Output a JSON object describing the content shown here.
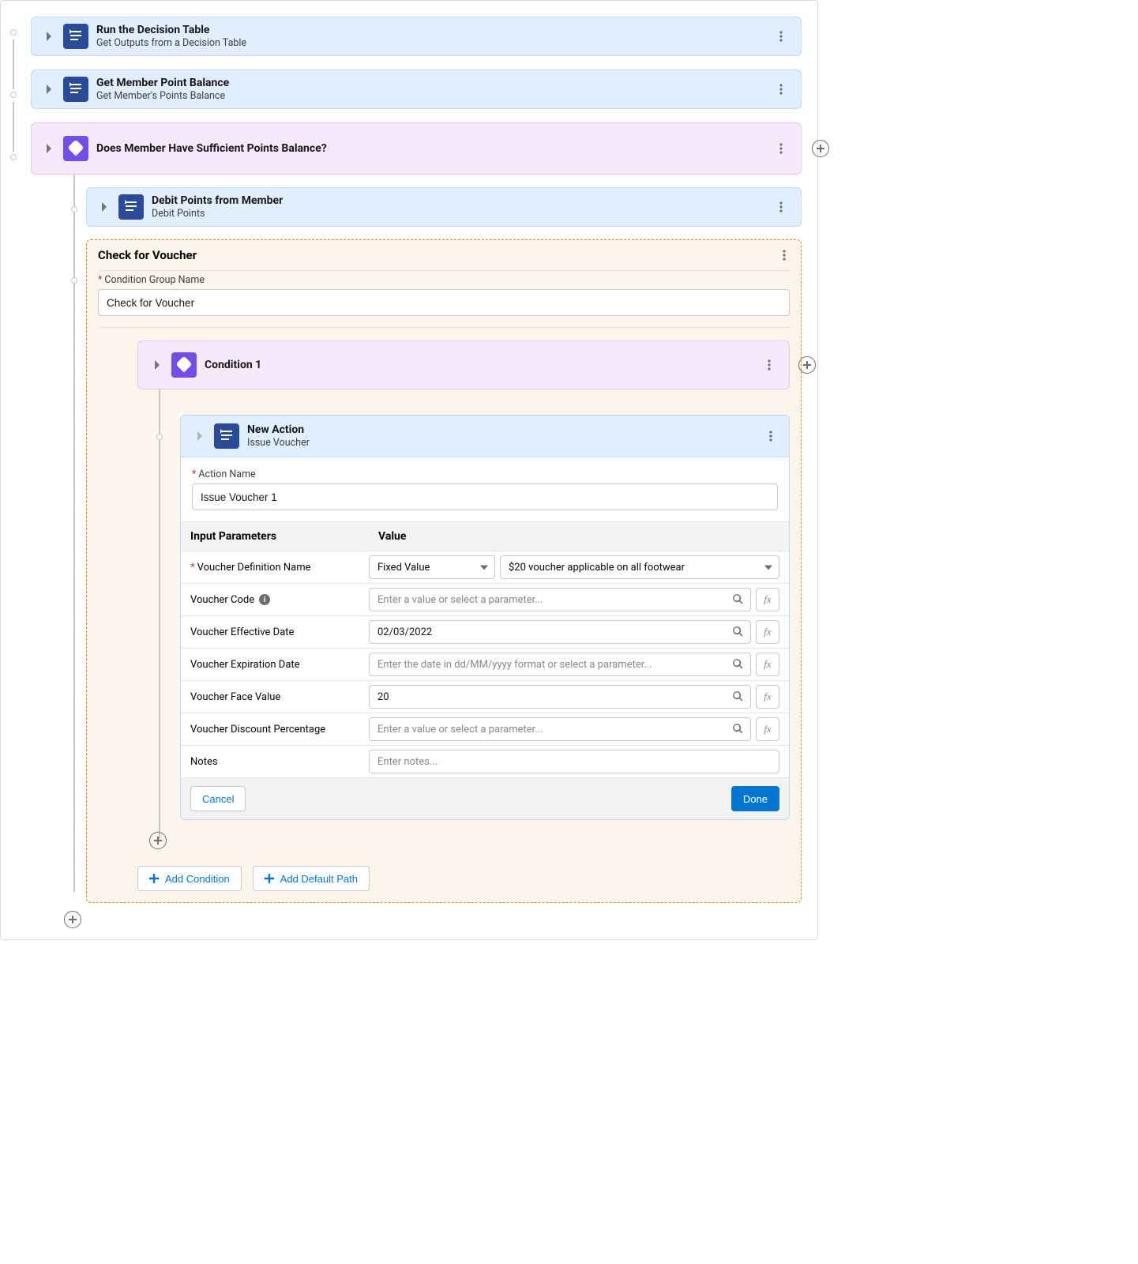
{
  "steps": {
    "decision_table": {
      "title": "Run the Decision Table",
      "subtitle": "Get Outputs from a Decision Table"
    },
    "member_balance": {
      "title": "Get Member Point Balance",
      "subtitle": "Get Member's Points Balance"
    },
    "sufficient_points": {
      "title": "Does Member Have Sufficient Points Balance?"
    },
    "debit_points": {
      "title": "Debit Points from Member",
      "subtitle": "Debit Points"
    }
  },
  "voucher_panel": {
    "title": "Check for Voucher",
    "group_name_label": "Condition Group Name",
    "group_name_value": "Check for Voucher",
    "condition_title": "Condition 1",
    "action": {
      "title": "New Action",
      "subtitle": "Issue Voucher",
      "name_label": "Action Name",
      "name_value": "Issue Voucher 1",
      "headers": {
        "params": "Input Parameters",
        "value": "Value"
      },
      "rows": {
        "voucher_def": {
          "label": "Voucher Definition Name",
          "type_value": "Fixed Value",
          "select_value": "$20 voucher applicable on all footwear"
        },
        "voucher_code": {
          "label": "Voucher Code",
          "placeholder": "Enter a value or select a parameter..."
        },
        "eff_date": {
          "label": "Voucher Effective Date",
          "value": "02/03/2022"
        },
        "exp_date": {
          "label": "Voucher Expiration Date",
          "placeholder": "Enter the date in dd/MM/yyyy format or select a parameter..."
        },
        "face_value": {
          "label": "Voucher Face Value",
          "value": "20"
        },
        "discount_pct": {
          "label": "Voucher Discount Percentage",
          "placeholder": "Enter a value or select a parameter..."
        },
        "notes": {
          "label": "Notes",
          "placeholder": "Enter notes..."
        }
      },
      "cancel": "Cancel",
      "done": "Done"
    },
    "add_condition": "Add Condition",
    "add_default_path": "Add Default Path"
  }
}
